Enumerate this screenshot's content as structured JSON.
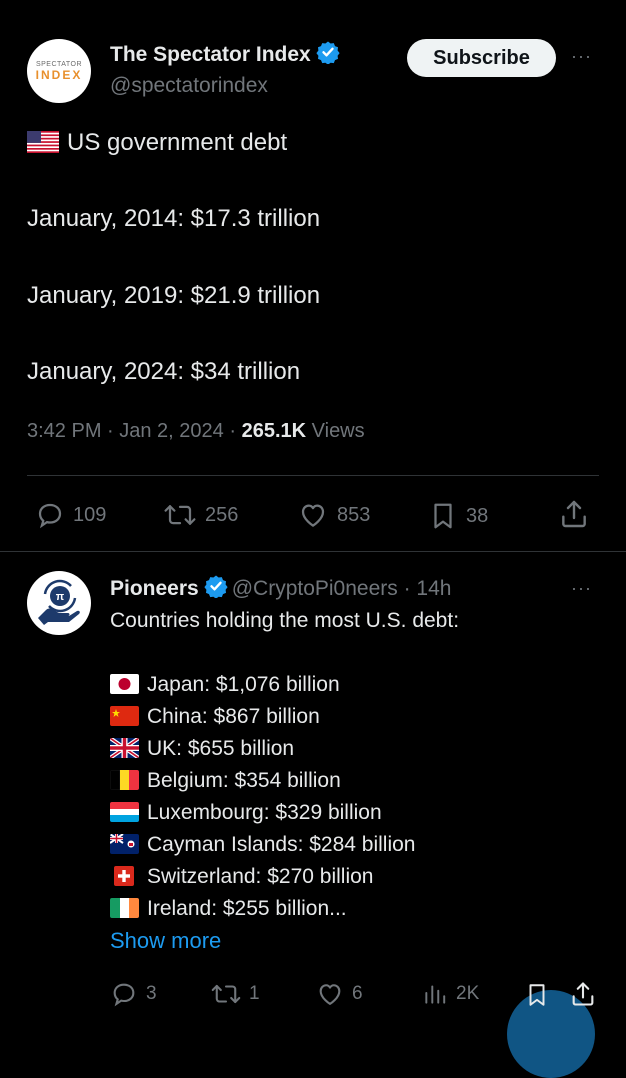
{
  "main_tweet": {
    "author_name": "The Spectator Index",
    "handle": "@spectatorindex",
    "avatar_text": [
      "SPECTATOR",
      "INDEX"
    ],
    "subscribe_label": "Subscribe",
    "more_label": "···",
    "lines": [
      "US government debt",
      "January, 2014: $17.3 trillion",
      "January, 2019: $21.9 trillion",
      "January, 2024: $34 trillion"
    ],
    "time": "3:42 PM · Jan 2, 2024 ·",
    "views_count": "265.1K",
    "views_label": "Views",
    "actions": {
      "replies": "109",
      "retweets": "256",
      "likes": "853",
      "bookmarks": "38"
    }
  },
  "reply": {
    "author_name": "Pioneers",
    "handle_time": "@CryptoPi0neers · 14h",
    "more_label": "···",
    "intro": "Countries holding the most U.S. debt:",
    "countries": [
      {
        "flag": "japan",
        "text": "Japan: $1,076 billion"
      },
      {
        "flag": "china",
        "text": "China: $867 billion"
      },
      {
        "flag": "uk",
        "text": "UK: $655 billion"
      },
      {
        "flag": "belgium",
        "text": "Belgium: $354 billion"
      },
      {
        "flag": "luxembourg",
        "text": "Luxembourg: $329 billion"
      },
      {
        "flag": "cayman",
        "text": "Cayman Islands: $284 billion"
      },
      {
        "flag": "switzerland",
        "text": "Switzerland: $270 billion"
      },
      {
        "flag": "ireland",
        "text": "Ireland: $255 billion..."
      }
    ],
    "show_more": "Show more",
    "actions": {
      "replies": "3",
      "retweets": "1",
      "likes": "6",
      "views": "2K"
    }
  },
  "colors": {
    "background": "#000000",
    "text": "#e7e9ea",
    "muted": "#71767b",
    "accent": "#1d9bf0",
    "verified": "#1d9bf0"
  }
}
